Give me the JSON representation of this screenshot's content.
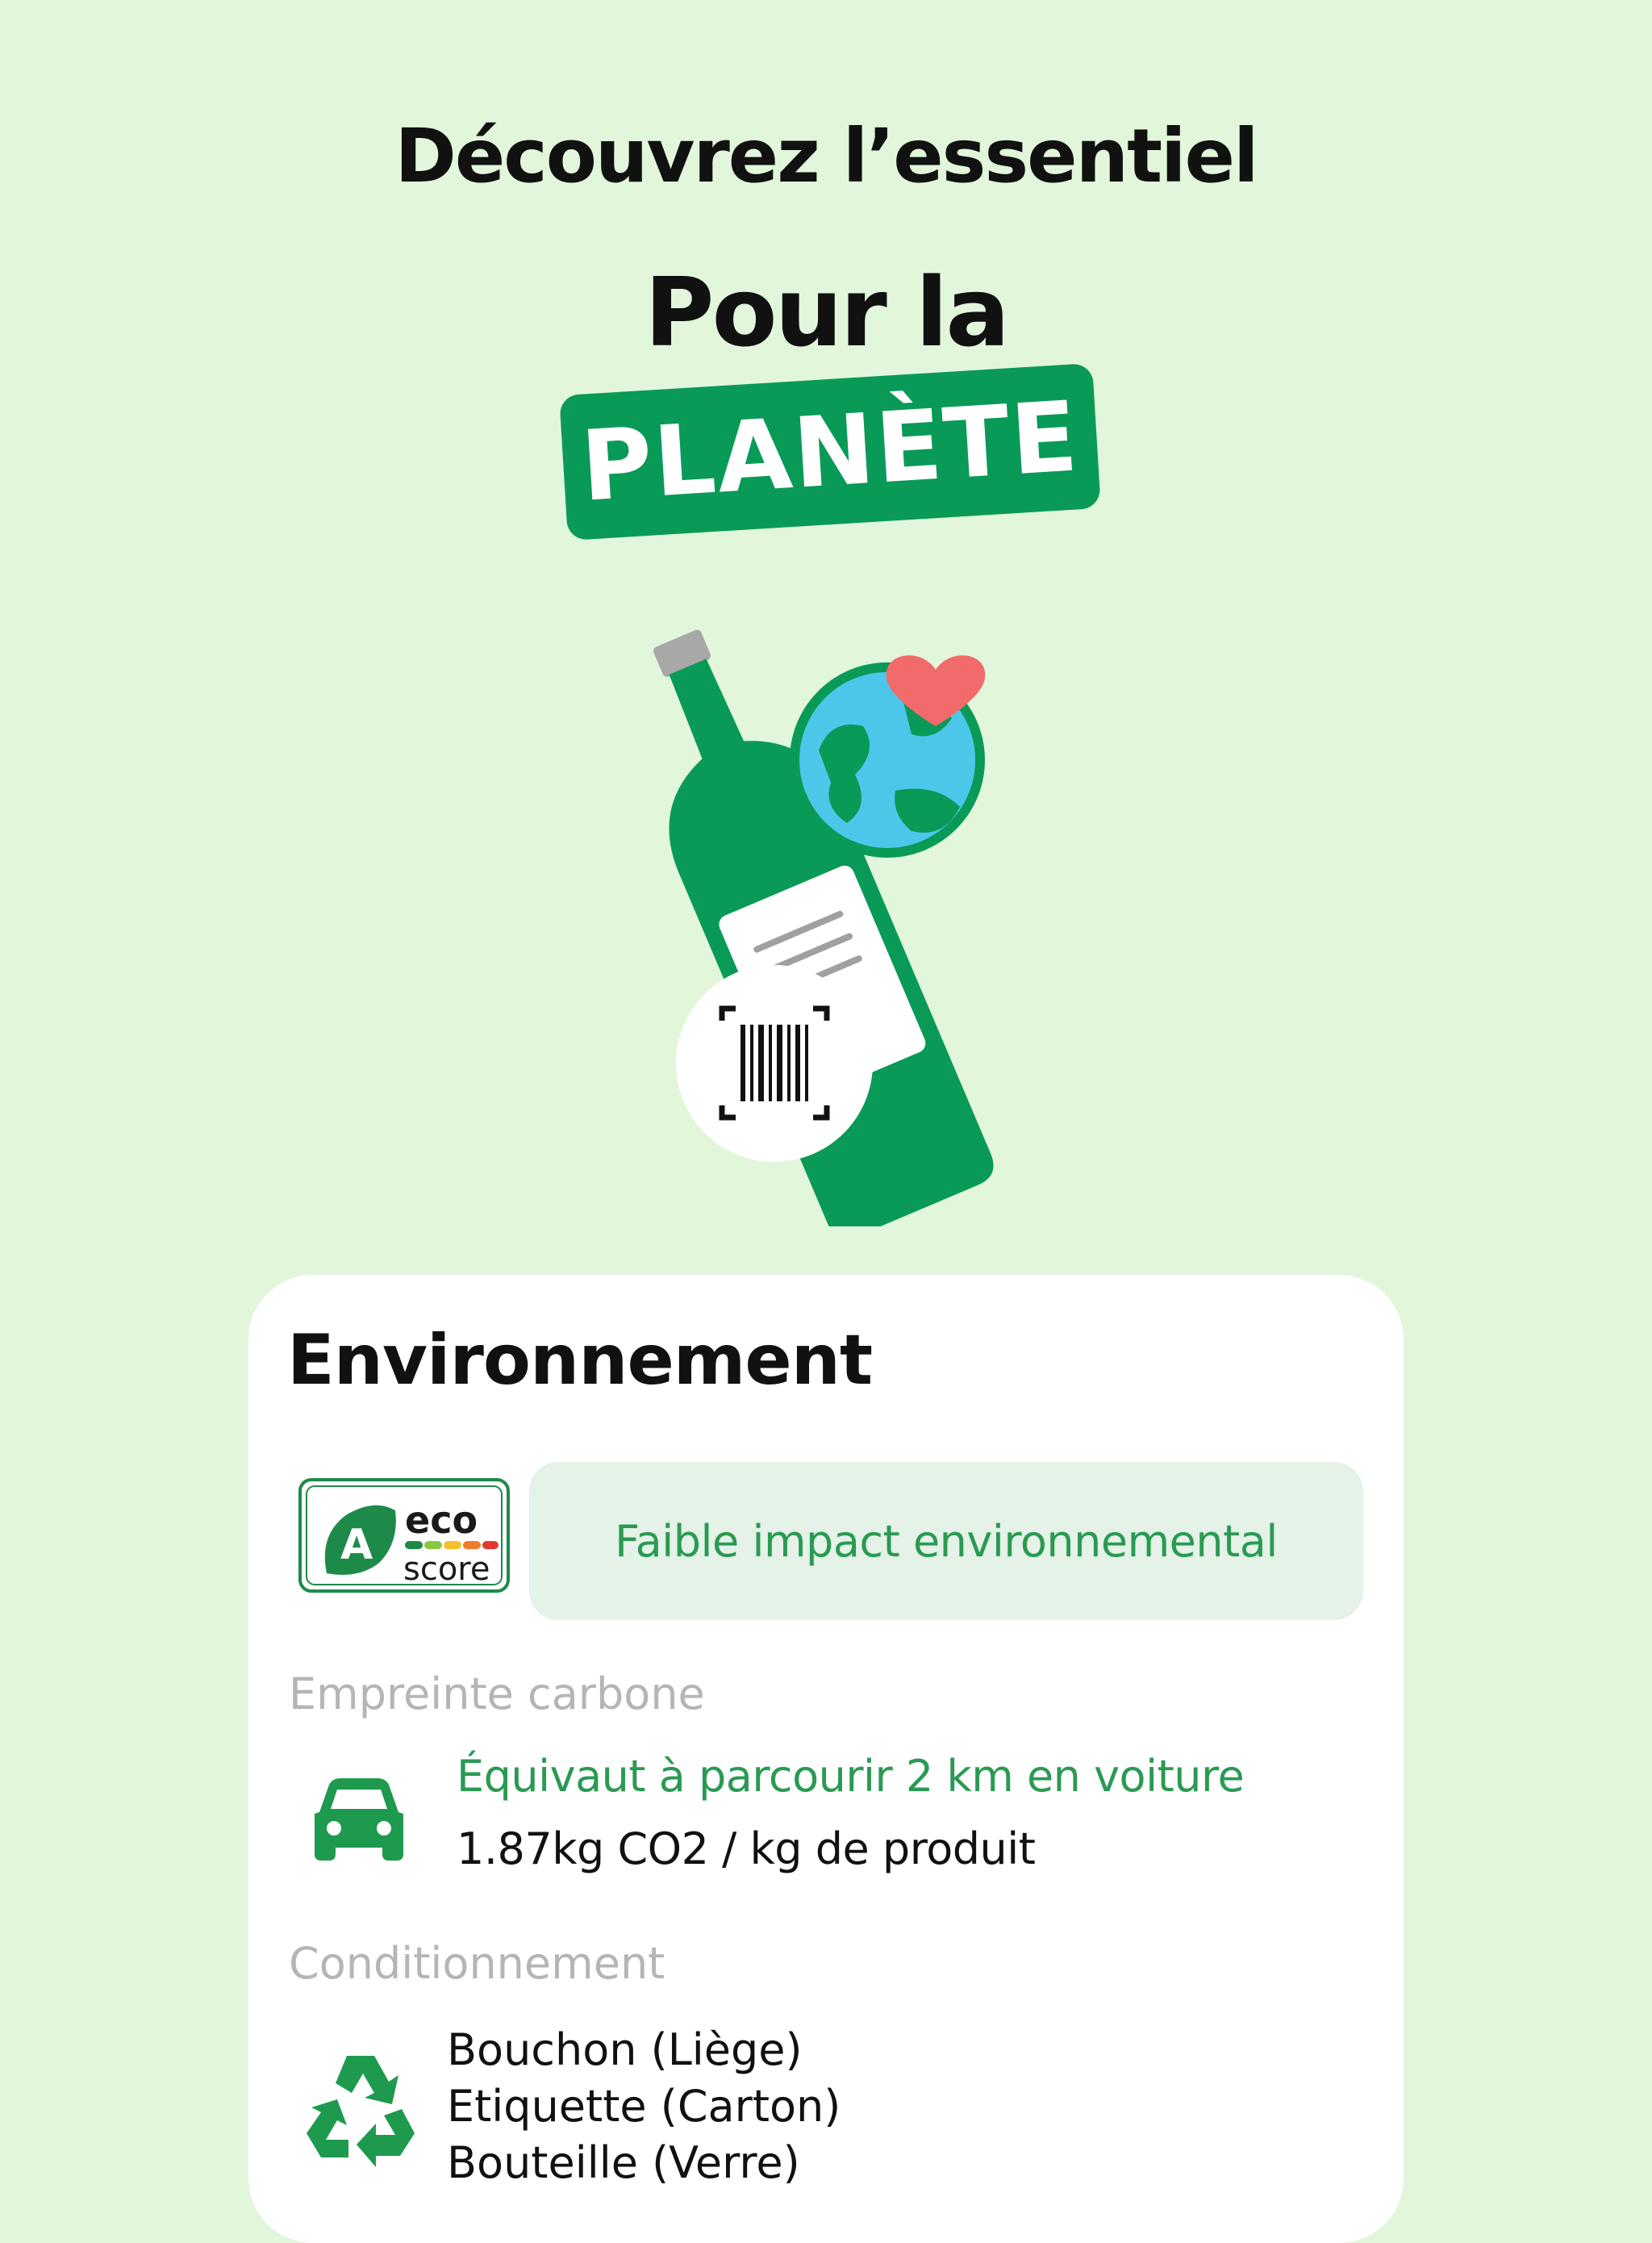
{
  "headline": {
    "line1": "Découvrez l’essentiel",
    "line2": "Pour la",
    "badge": "PLANÈTE"
  },
  "environment_card": {
    "title": "Environnement",
    "ecoscore": {
      "grade": "A",
      "word_top": "eco",
      "word_bottom": "score",
      "impact_text": "Faible impact environnemental"
    },
    "carbon": {
      "label": "Empreinte carbone",
      "equivalent": "Équivaut à parcourir 2 km en voiture",
      "value": "1.87kg CO2 / kg de produit",
      "icon": "car-icon"
    },
    "packaging": {
      "label": "Conditionnement",
      "icon": "recycle-icon",
      "items": [
        "Bouchon (Liège)",
        "Etiquette (Carton)",
        "Bouteille (Verre)"
      ]
    }
  },
  "colors": {
    "background": "#e2f6dc",
    "accent_green": "#0a9a57",
    "text_green": "#2a9a52",
    "pill_bg": "#e4f2e8",
    "muted": "#b5b5b5"
  }
}
